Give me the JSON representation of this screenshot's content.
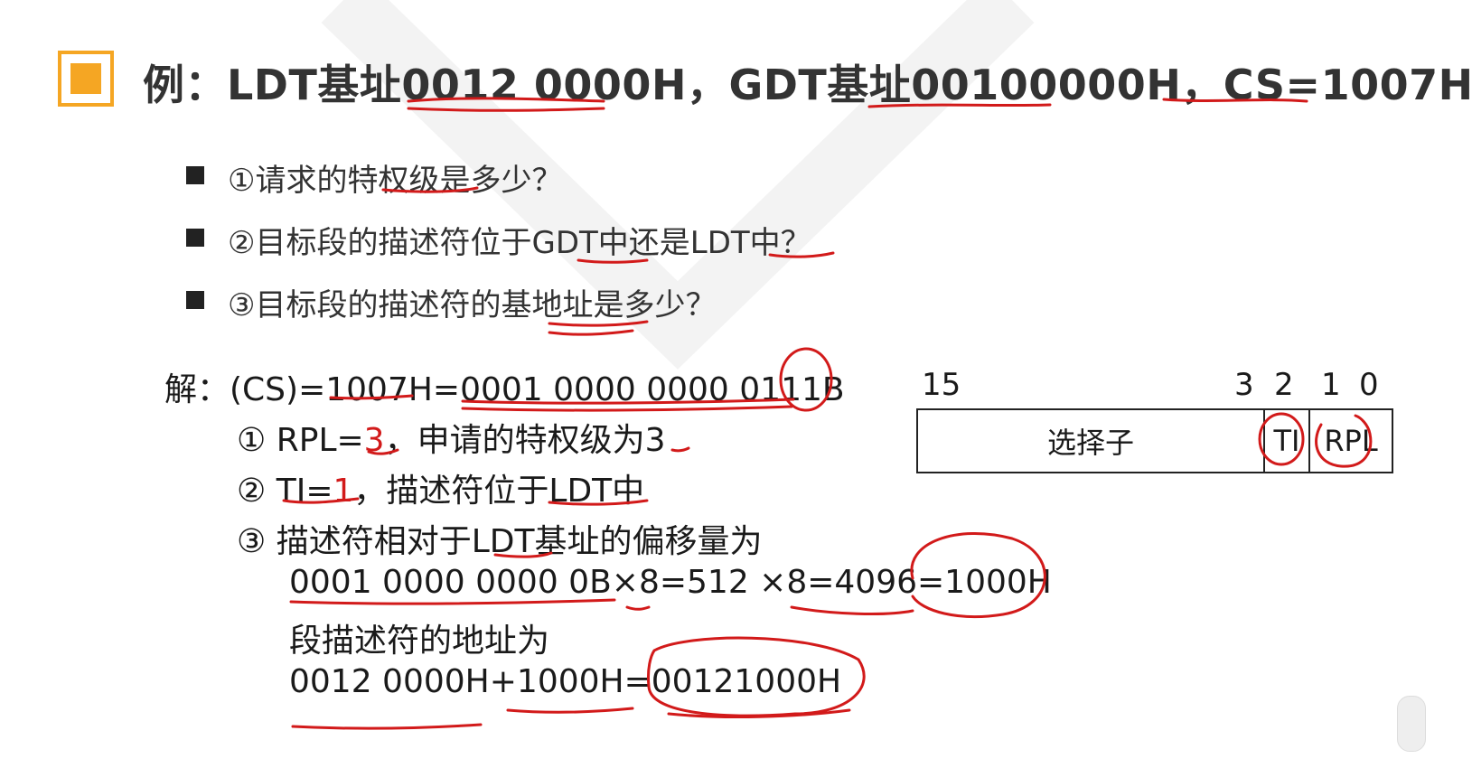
{
  "title": "例：LDT基址0012 0000H，GDT基址00100000H，CS=1007H",
  "questions": [
    "①请求的特权级是多少？",
    "②目标段的描述符位于GDT中还是LDT中？",
    "③目标段的描述符的基地址是多少？"
  ],
  "solution": {
    "line1": "解：(CS)=1007H=0001 0000 0000 0111B",
    "item1_prefix": "① RPL=",
    "item1_value": "3",
    "item1_suffix": "，申请的特权级为3",
    "item2_prefix": "② TI=",
    "item2_value": "1",
    "item2_suffix": "，描述符位于LDT中",
    "item3": "③ 描述符相对于LDT基址的偏移量为",
    "calc1": "0001 0000 0000 0B×8=512 ×8=4096=1000H",
    "addr_label": "段描述符的地址为",
    "calc2": "0012 0000H+1000H=00121000H"
  },
  "selector_register": {
    "bit_15": "15",
    "bit_3": "3",
    "bit_2": "2",
    "bit_1": "1",
    "bit_0": "0",
    "field_selector": "选择子",
    "field_ti": "TI",
    "field_rpl": "RPL"
  },
  "colors": {
    "accent": "#f5a623",
    "annotation_red": "#d21a1a",
    "text": "#333333"
  }
}
